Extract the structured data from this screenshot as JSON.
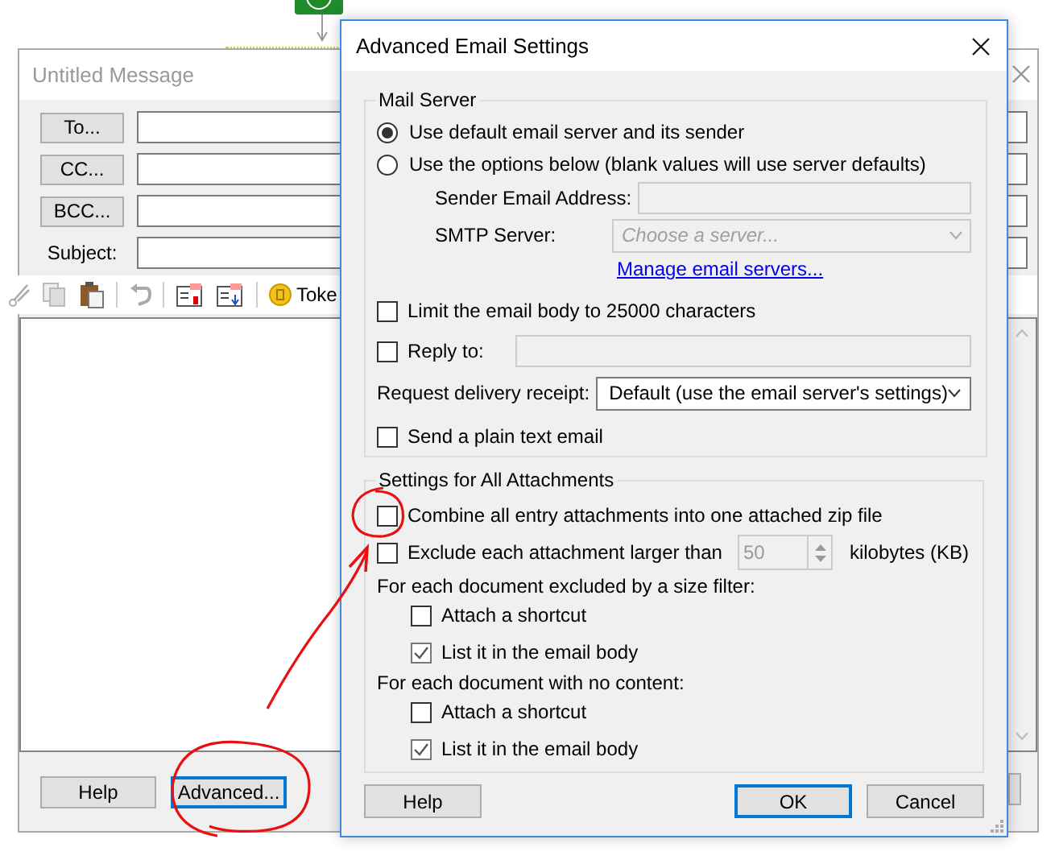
{
  "background_window": {
    "title": "Untitled Message",
    "address_buttons": [
      "To...",
      "CC...",
      "BCC..."
    ],
    "subject_label": "Subject:",
    "toolbar_text": "Toke",
    "buttons": [
      {
        "label": "Help",
        "focused": false
      },
      {
        "label": "Advanced...",
        "focused": true
      }
    ]
  },
  "dialog": {
    "title": "Advanced Email Settings",
    "mail_server": {
      "legend": "Mail Server",
      "options": [
        {
          "label": "Use default email server and its sender",
          "selected": true
        },
        {
          "label": "Use the options below (blank values will use server defaults)",
          "selected": false
        }
      ],
      "sender_label": "Sender Email Address:",
      "sender_field": {
        "disabled": true
      },
      "smtp_label": "SMTP Server:",
      "smtp_field": {
        "placeholder": "Choose a server...",
        "disabled": true
      },
      "manage_link": "Manage email servers...",
      "limit_body": {
        "label": "Limit the email body to 25000 characters",
        "checked": false
      },
      "reply_to": {
        "label": "Reply to:",
        "checked": false,
        "disabled": true
      },
      "receipt_label": "Request delivery receipt:",
      "receipt_value": "Default (use the email server's settings)",
      "plain_text": {
        "label": "Send a plain text email",
        "checked": false
      }
    },
    "attachments": {
      "legend": "Settings for All Attachments",
      "combine": {
        "label": "Combine all entry attachments into one attached zip file",
        "checked": false
      },
      "exclude": {
        "label": "Exclude each attachment larger than",
        "checked": false,
        "size_value": "50",
        "disabled": true,
        "unit": "kilobytes (KB)"
      },
      "groups": [
        {
          "heading": "For each document excluded by a size filter:",
          "options": [
            {
              "label": "Attach a shortcut",
              "checked": false
            },
            {
              "label": "List it in the email body",
              "checked": true
            }
          ]
        },
        {
          "heading": "For each document with no content:",
          "options": [
            {
              "label": "Attach a shortcut",
              "checked": false
            },
            {
              "label": "List it in the email body",
              "checked": true
            }
          ]
        }
      ]
    },
    "buttons": [
      {
        "label": "Help",
        "default": false
      },
      {
        "label": "OK",
        "default": true
      },
      {
        "label": "Cancel",
        "default": false
      }
    ]
  }
}
